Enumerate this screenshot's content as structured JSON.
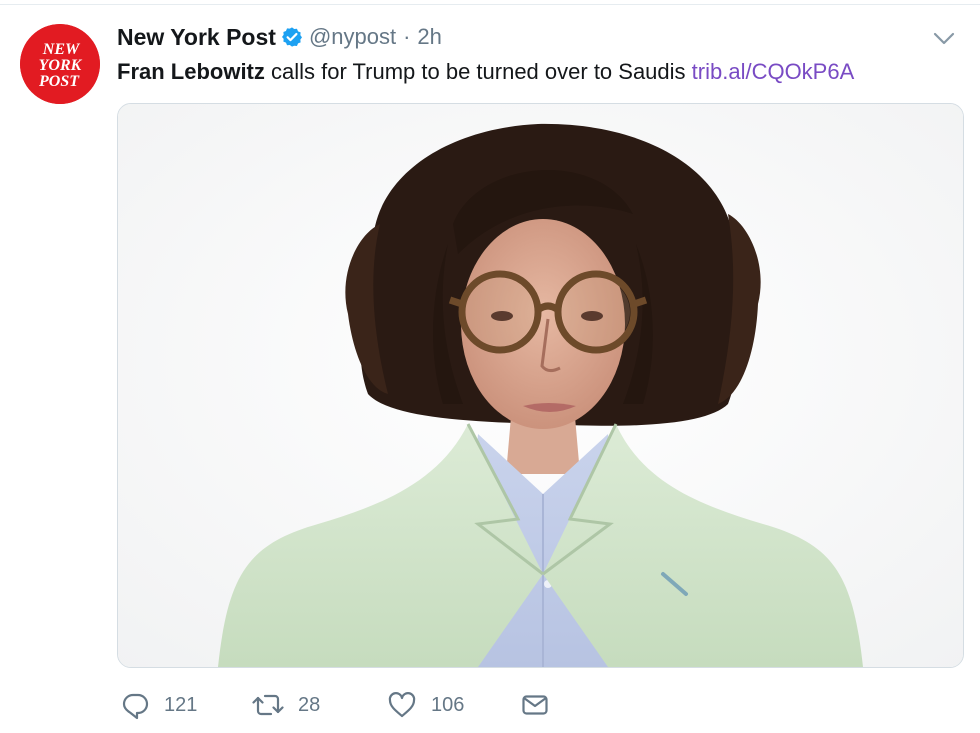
{
  "tweet": {
    "author": {
      "display_name": "New York Post",
      "handle": "@nypost",
      "avatar_text": [
        "NEW",
        "YORK",
        "POST"
      ],
      "verified": true
    },
    "separator": "·",
    "time": "2h",
    "text": {
      "bold": "Fran Lebowitz",
      "rest": " calls for Trump to be turned over to Saudis ",
      "link": "trib.al/CQOkP6A"
    },
    "media": {
      "kind": "photo"
    },
    "actions": {
      "reply": {
        "icon": "reply-icon",
        "count": "121"
      },
      "retweet": {
        "icon": "retweet-icon",
        "count": "28"
      },
      "like": {
        "icon": "heart-icon",
        "count": "106"
      },
      "dm": {
        "icon": "envelope-icon"
      }
    }
  },
  "colors": {
    "brand_red": "#e21b22",
    "link": "#794bc4",
    "verified_blue": "#1da1f2",
    "muted": "#657786"
  }
}
